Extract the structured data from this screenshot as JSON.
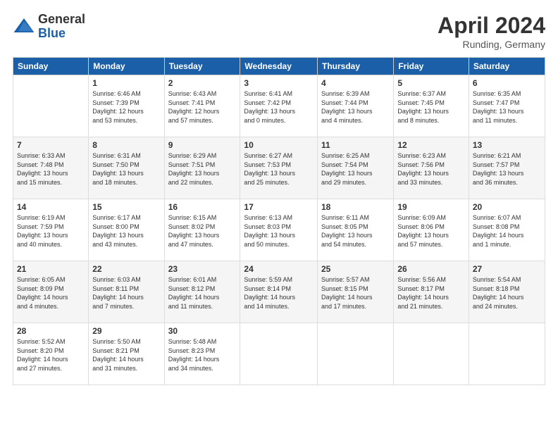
{
  "header": {
    "logo_general": "General",
    "logo_blue": "Blue",
    "title": "April 2024",
    "location": "Runding, Germany"
  },
  "days_of_week": [
    "Sunday",
    "Monday",
    "Tuesday",
    "Wednesday",
    "Thursday",
    "Friday",
    "Saturday"
  ],
  "weeks": [
    [
      {
        "day": "",
        "info": ""
      },
      {
        "day": "1",
        "info": "Sunrise: 6:46 AM\nSunset: 7:39 PM\nDaylight: 12 hours\nand 53 minutes."
      },
      {
        "day": "2",
        "info": "Sunrise: 6:43 AM\nSunset: 7:41 PM\nDaylight: 12 hours\nand 57 minutes."
      },
      {
        "day": "3",
        "info": "Sunrise: 6:41 AM\nSunset: 7:42 PM\nDaylight: 13 hours\nand 0 minutes."
      },
      {
        "day": "4",
        "info": "Sunrise: 6:39 AM\nSunset: 7:44 PM\nDaylight: 13 hours\nand 4 minutes."
      },
      {
        "day": "5",
        "info": "Sunrise: 6:37 AM\nSunset: 7:45 PM\nDaylight: 13 hours\nand 8 minutes."
      },
      {
        "day": "6",
        "info": "Sunrise: 6:35 AM\nSunset: 7:47 PM\nDaylight: 13 hours\nand 11 minutes."
      }
    ],
    [
      {
        "day": "7",
        "info": "Sunrise: 6:33 AM\nSunset: 7:48 PM\nDaylight: 13 hours\nand 15 minutes."
      },
      {
        "day": "8",
        "info": "Sunrise: 6:31 AM\nSunset: 7:50 PM\nDaylight: 13 hours\nand 18 minutes."
      },
      {
        "day": "9",
        "info": "Sunrise: 6:29 AM\nSunset: 7:51 PM\nDaylight: 13 hours\nand 22 minutes."
      },
      {
        "day": "10",
        "info": "Sunrise: 6:27 AM\nSunset: 7:53 PM\nDaylight: 13 hours\nand 25 minutes."
      },
      {
        "day": "11",
        "info": "Sunrise: 6:25 AM\nSunset: 7:54 PM\nDaylight: 13 hours\nand 29 minutes."
      },
      {
        "day": "12",
        "info": "Sunrise: 6:23 AM\nSunset: 7:56 PM\nDaylight: 13 hours\nand 33 minutes."
      },
      {
        "day": "13",
        "info": "Sunrise: 6:21 AM\nSunset: 7:57 PM\nDaylight: 13 hours\nand 36 minutes."
      }
    ],
    [
      {
        "day": "14",
        "info": "Sunrise: 6:19 AM\nSunset: 7:59 PM\nDaylight: 13 hours\nand 40 minutes."
      },
      {
        "day": "15",
        "info": "Sunrise: 6:17 AM\nSunset: 8:00 PM\nDaylight: 13 hours\nand 43 minutes."
      },
      {
        "day": "16",
        "info": "Sunrise: 6:15 AM\nSunset: 8:02 PM\nDaylight: 13 hours\nand 47 minutes."
      },
      {
        "day": "17",
        "info": "Sunrise: 6:13 AM\nSunset: 8:03 PM\nDaylight: 13 hours\nand 50 minutes."
      },
      {
        "day": "18",
        "info": "Sunrise: 6:11 AM\nSunset: 8:05 PM\nDaylight: 13 hours\nand 54 minutes."
      },
      {
        "day": "19",
        "info": "Sunrise: 6:09 AM\nSunset: 8:06 PM\nDaylight: 13 hours\nand 57 minutes."
      },
      {
        "day": "20",
        "info": "Sunrise: 6:07 AM\nSunset: 8:08 PM\nDaylight: 14 hours\nand 1 minute."
      }
    ],
    [
      {
        "day": "21",
        "info": "Sunrise: 6:05 AM\nSunset: 8:09 PM\nDaylight: 14 hours\nand 4 minutes."
      },
      {
        "day": "22",
        "info": "Sunrise: 6:03 AM\nSunset: 8:11 PM\nDaylight: 14 hours\nand 7 minutes."
      },
      {
        "day": "23",
        "info": "Sunrise: 6:01 AM\nSunset: 8:12 PM\nDaylight: 14 hours\nand 11 minutes."
      },
      {
        "day": "24",
        "info": "Sunrise: 5:59 AM\nSunset: 8:14 PM\nDaylight: 14 hours\nand 14 minutes."
      },
      {
        "day": "25",
        "info": "Sunrise: 5:57 AM\nSunset: 8:15 PM\nDaylight: 14 hours\nand 17 minutes."
      },
      {
        "day": "26",
        "info": "Sunrise: 5:56 AM\nSunset: 8:17 PM\nDaylight: 14 hours\nand 21 minutes."
      },
      {
        "day": "27",
        "info": "Sunrise: 5:54 AM\nSunset: 8:18 PM\nDaylight: 14 hours\nand 24 minutes."
      }
    ],
    [
      {
        "day": "28",
        "info": "Sunrise: 5:52 AM\nSunset: 8:20 PM\nDaylight: 14 hours\nand 27 minutes."
      },
      {
        "day": "29",
        "info": "Sunrise: 5:50 AM\nSunset: 8:21 PM\nDaylight: 14 hours\nand 31 minutes."
      },
      {
        "day": "30",
        "info": "Sunrise: 5:48 AM\nSunset: 8:23 PM\nDaylight: 14 hours\nand 34 minutes."
      },
      {
        "day": "",
        "info": ""
      },
      {
        "day": "",
        "info": ""
      },
      {
        "day": "",
        "info": ""
      },
      {
        "day": "",
        "info": ""
      }
    ]
  ]
}
